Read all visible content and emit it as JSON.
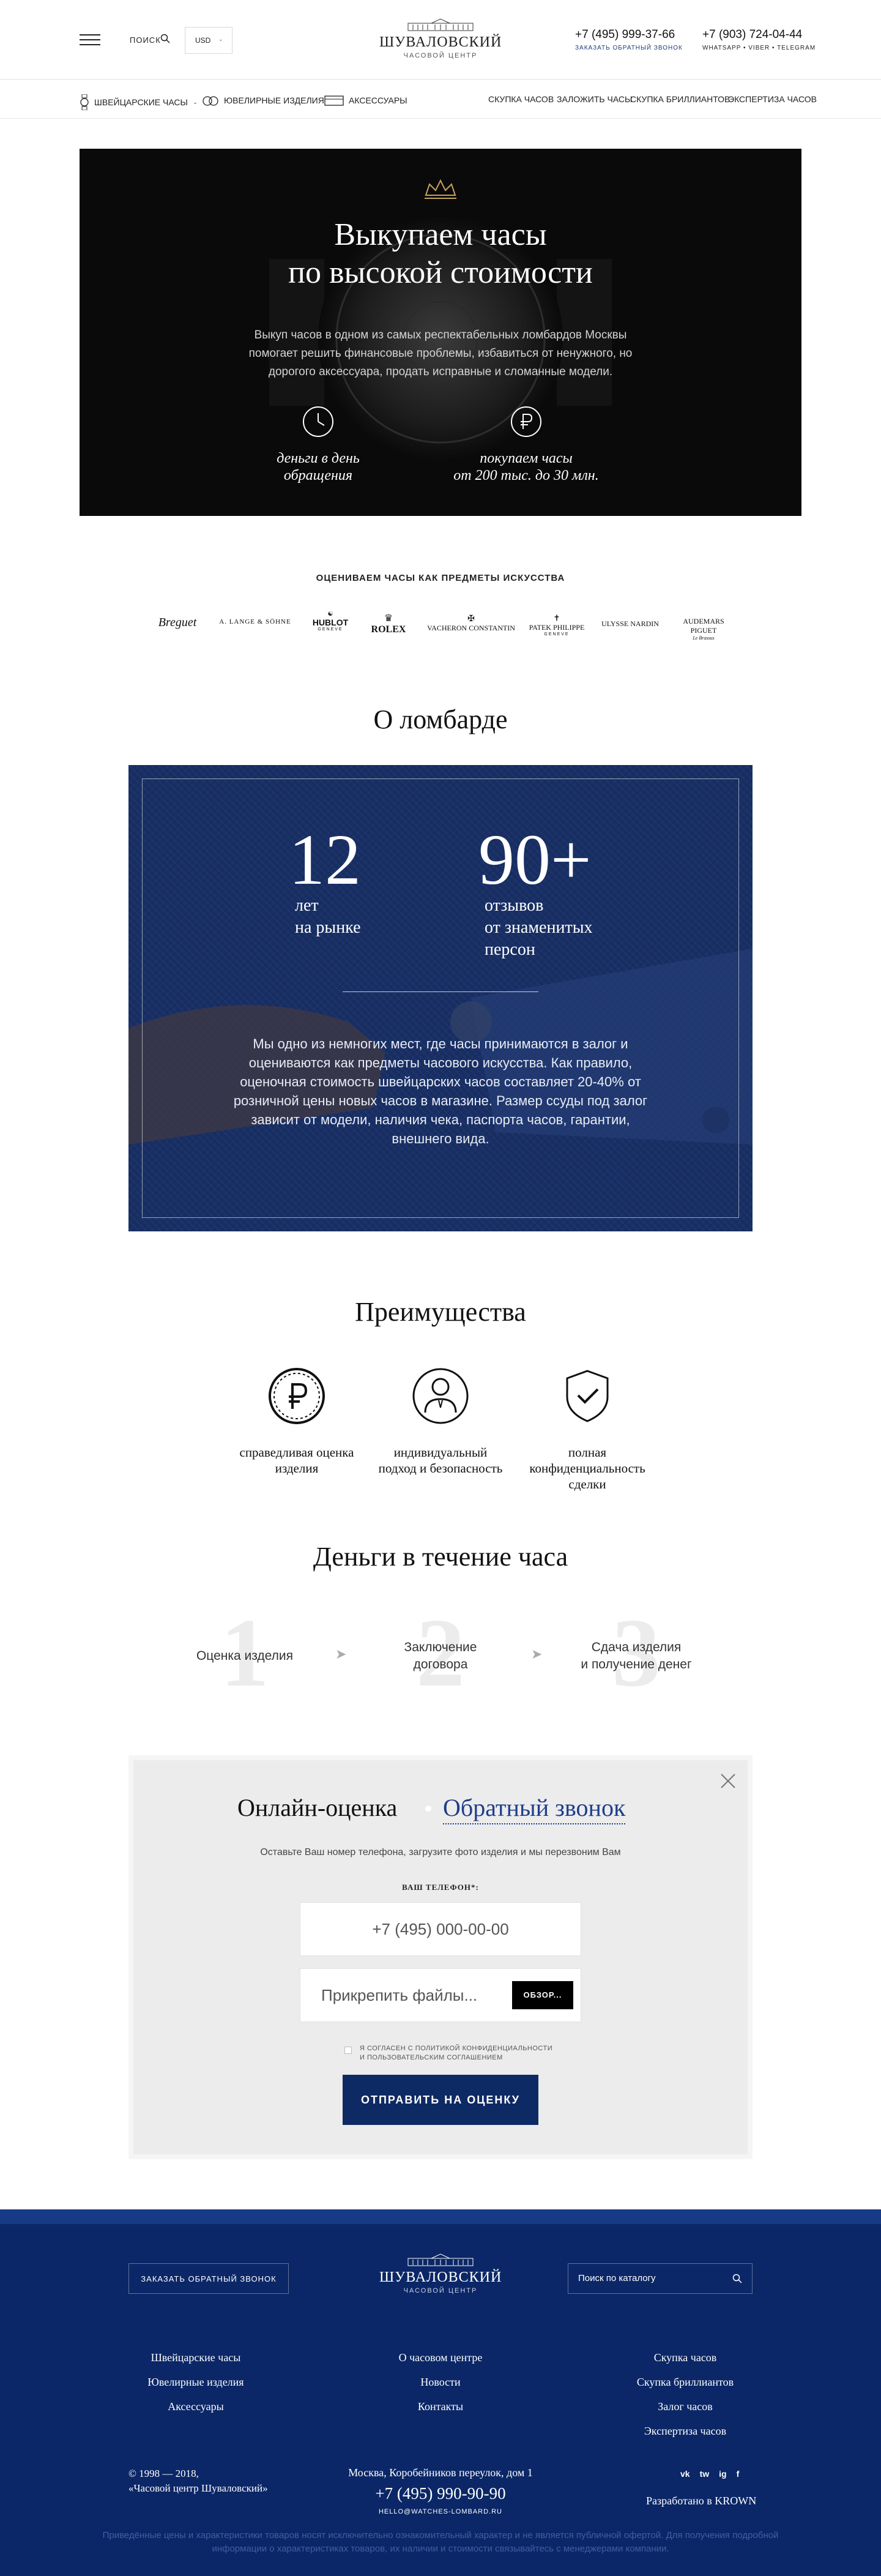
{
  "header": {
    "search_label": "ПОИСК",
    "currency": "USD",
    "logo_name": "ШУВАЛОВСКИЙ",
    "logo_sub": "ЧАСОВОЙ ЦЕНТР",
    "phone1": "+7 (495) 999-37-66",
    "callback_label": "ЗАКАЗАТЬ ОБРАТНЫЙ ЗВОНОК",
    "phone2": "+7 (903) 724-04-44",
    "messengers": "WHATSAPP • VIBER • TELEGRAM"
  },
  "nav": {
    "categories": [
      "ШВЕЙЦАРСКИЕ ЧАСЫ",
      "ЮВЕЛИРНЫЕ ИЗДЕЛИЯ",
      "АКСЕССУАРЫ"
    ],
    "links": [
      "СКУПКА ЧАСОВ",
      "ЗАЛОЖИТЬ ЧАСЫ",
      "СКУПКА БРИЛЛИАНТОВ",
      "ЭКСПЕРТИЗА ЧАСОВ"
    ]
  },
  "hero": {
    "title_line1": "Выкупаем часы",
    "title_line2": "по высокой стоимости",
    "text": "Выкуп часов в одном из самых респектабельных ломбардов Москвы помогает решить финансовые проблемы, избавиться от ненужного, но дорогого аксессуара, продать исправные и сломанные модели.",
    "features": [
      {
        "icon": "clock-icon",
        "line1": "деньги в день",
        "line2": "обращения"
      },
      {
        "icon": "ruble-icon",
        "line1": "покупаем часы",
        "line2": "от 200 тыс. до 30 млн."
      }
    ]
  },
  "brands": {
    "title": "ОЦЕНИВАЕМ ЧАСЫ КАК ПРЕДМЕТЫ ИСКУССТВА",
    "items": [
      "Breguet",
      "A. LANGE & SÖHNE",
      "HUBLOT",
      "ROLEX",
      "VACHERON CONSTANTIN",
      "PATEK PHILIPPE",
      "ULYSSE NARDIN",
      "AUDEMARS PIGUET"
    ],
    "subs": [
      "",
      "",
      "GENEVE",
      "",
      "",
      "GENEVE",
      "",
      "Le Brassus"
    ]
  },
  "about": {
    "title": "О ломбарде",
    "stat1_num": "12",
    "stat1_l1": "лет",
    "stat1_l2": "на рынке",
    "stat2_num": "90+",
    "stat2_l1": "отзывов",
    "stat2_l2": "от знаменитых",
    "stat2_l3": "персон",
    "text": "Мы одно из немногих мест, где часы принимаются в залог и оцениваются как предметы часового искусства. Как правило, оценочная стоимость швейцарских часов составляет 20-40% от розничной цены новых часов в магазине. Размер ссуды под залог зависит от модели, наличия чека, паспорта часов, гарантии, внешнего вида."
  },
  "advantages": {
    "title": "Преимущества",
    "items": [
      {
        "icon": "ruble-coin-icon",
        "l1": "справедливая оценка",
        "l2": "изделия",
        "l3": ""
      },
      {
        "icon": "person-icon",
        "l1": "индивидуальный",
        "l2": "подход и безопасность",
        "l3": ""
      },
      {
        "icon": "shield-check-icon",
        "l1": "полная",
        "l2": "конфиденциальность",
        "l3": "сделки"
      }
    ]
  },
  "steps": {
    "title": "Деньги в течение часа",
    "items": [
      {
        "num": "1",
        "l1": "Оценка изделия",
        "l2": ""
      },
      {
        "num": "2",
        "l1": "Заключение",
        "l2": "договора"
      },
      {
        "num": "3",
        "l1": "Сдача изделия",
        "l2": "и получение денег"
      }
    ]
  },
  "form": {
    "tab1": "Онлайн-оценка",
    "tab2": "Обратный звонок",
    "desc": "Оставьте Ваш номер телефона, загрузите фото изделия и мы перезвоним Вам",
    "phone_label": "ВАШ ТЕЛЕФОН*:",
    "phone_placeholder": "+7 (495) 000-00-00",
    "file_placeholder": "Прикрепить файлы...",
    "browse": "ОБЗОР...",
    "consent_l1": "Я СОГЛАСЕН С ПОЛИТИКОЙ КОНФИДЕНЦИАЛЬНОСТИ",
    "consent_l2": "И ПОЛЬЗОВАТЕЛЬСКИМ СОГЛАШЕНИЕМ",
    "submit": "ОТПРАВИТЬ НА ОЦЕНКУ"
  },
  "footer": {
    "callback": "ЗАКАЗАТЬ ОБРАТНЫЙ ЗВОНОК",
    "logo_name": "ШУВАЛОВСКИЙ",
    "logo_sub": "ЧАСОВОЙ ЦЕНТР",
    "search_placeholder": "Поиск по каталогу",
    "col1": [
      "Швейцарские часы",
      "Ювелирные изделия",
      "Аксессуары"
    ],
    "col2": [
      "О часовом центре",
      "Новости",
      "Контакты"
    ],
    "col3": [
      "Скупка часов",
      "Скупка бриллиантов",
      "Залог часов",
      "Экспертиза часов"
    ],
    "copy_l1": "© 1998 — 2018,",
    "copy_l2": "«Часовой центр Шуваловский»",
    "address": "Москва, Коробейников переулок, дом 1",
    "phone": "+7 (495) 990-90-90",
    "email": "HELLO@WATCHES-LOMBARD.RU",
    "social": [
      "vk",
      "tw",
      "ig",
      "f"
    ],
    "developer": "Разработано в KROWN",
    "disclaimer": "Приведённые цены и характеристики товаров носят исключительно ознакомительный характер и не является публичной офертой. Для получения подробной информации о характеристиках товаров, их наличии и стоимости связывайтесь с менеджерами компании."
  },
  "colors": {
    "brand_blue": "#0b2767",
    "accent_blue": "#1f3f8a",
    "hero_bg": "#0a0a0a",
    "form_bg": "#ececec"
  }
}
